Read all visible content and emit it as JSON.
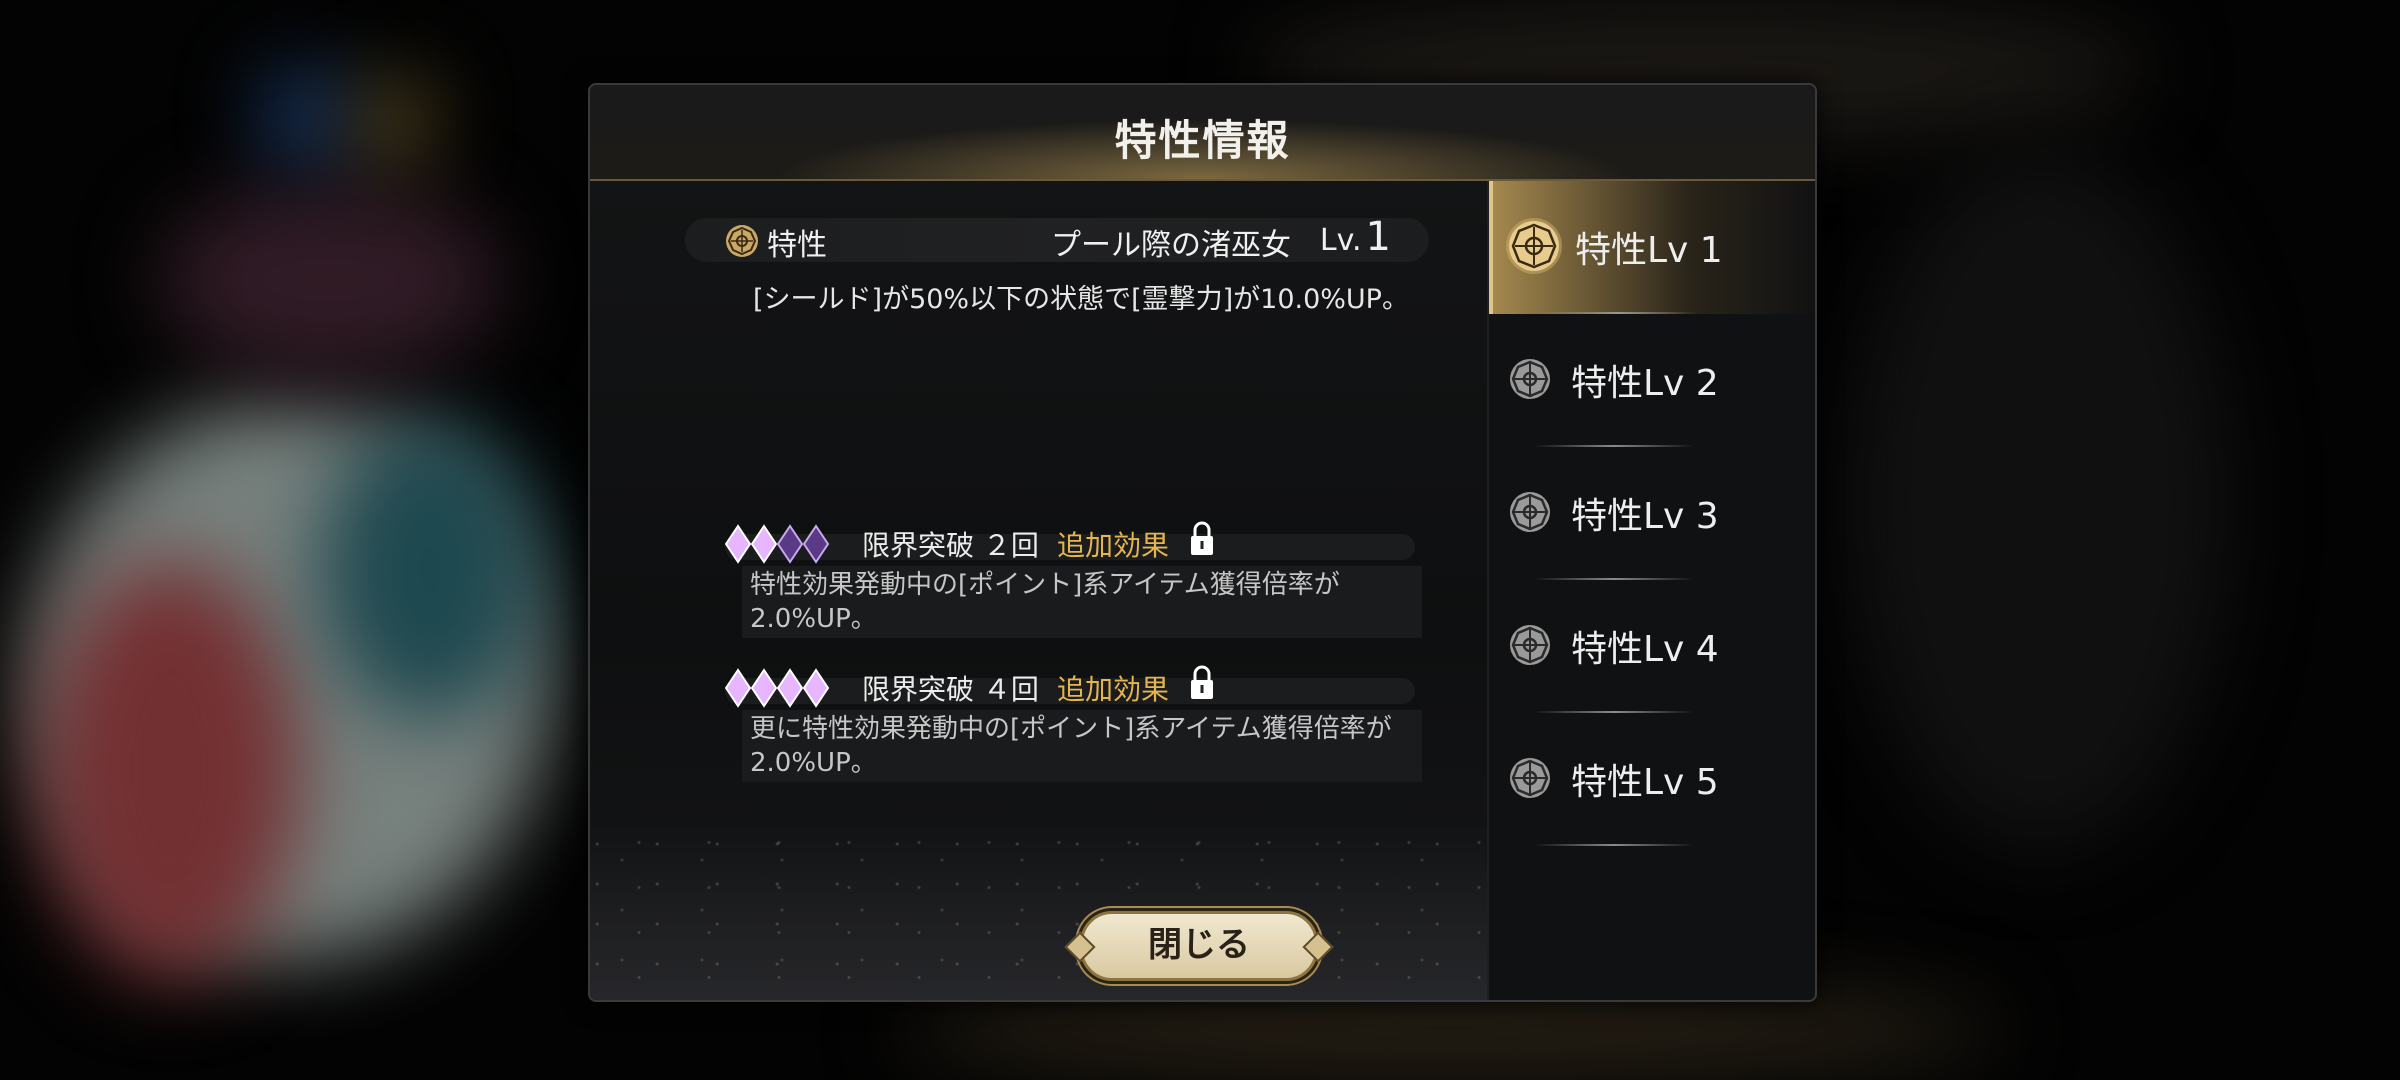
{
  "dialog": {
    "title": "特性情報",
    "trait": {
      "label": "特性",
      "name": "プール際の渚巫女",
      "level_prefix": "Lv.",
      "level": "1",
      "description": "[シールド]が50%以下の状態で[霊撃力]が10.0%UP。"
    },
    "limit_breaks": [
      {
        "filled_diamonds": 2,
        "total_diamonds": 4,
        "label": "限界突破 ２回",
        "extra_label": "追加効果",
        "locked": true,
        "effect_line1": "特性効果発動中の[ポイント]系アイテム獲得倍率が",
        "effect_line2": "2.0%UP。"
      },
      {
        "filled_diamonds": 4,
        "total_diamonds": 4,
        "label": "限界突破 ４回",
        "extra_label": "追加効果",
        "locked": true,
        "effect_line1": "更に特性効果発動中の[ポイント]系アイテム獲得倍率が",
        "effect_line2": "2.0%UP。"
      }
    ],
    "close_label": "閉じる"
  },
  "sidebar": {
    "tabs": [
      {
        "label": "特性Lv 1",
        "active": true
      },
      {
        "label": "特性Lv 2",
        "active": false
      },
      {
        "label": "特性Lv 3",
        "active": false
      },
      {
        "label": "特性Lv 4",
        "active": false
      },
      {
        "label": "特性Lv 5",
        "active": false
      }
    ]
  },
  "colors": {
    "accent_gold": "#e2c58a",
    "extra_effect": "#e5b552",
    "diamond_filled": "#e7b6ff",
    "diamond_empty": "#5a3a86"
  }
}
